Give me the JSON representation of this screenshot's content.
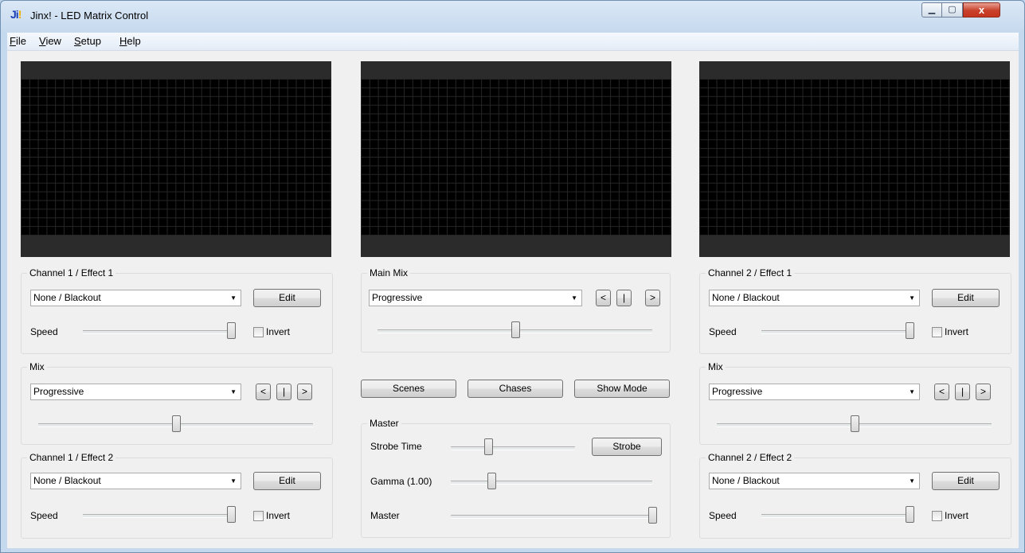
{
  "window": {
    "title": "Jinx! - LED Matrix Control",
    "logo": "Ji!",
    "minimize": "▁",
    "maximize": "▢",
    "close": "x"
  },
  "menu": [
    {
      "accel": "F",
      "rest": "ile"
    },
    {
      "accel": "V",
      "rest": "iew"
    },
    {
      "accel": "S",
      "rest": "etup"
    },
    {
      "accel": "H",
      "rest": "elp"
    }
  ],
  "ch1e1": {
    "legend": "Channel 1 / Effect 1",
    "effect": "None / Blackout",
    "edit": "Edit",
    "speed_label": "Speed",
    "invert_label": "Invert",
    "speed": 1.0,
    "invert": false
  },
  "mix1": {
    "legend": "Mix",
    "mode": "Progressive",
    "prev": "<",
    "stop": "|",
    "next": ">",
    "position": 0.5
  },
  "ch1e2": {
    "legend": "Channel 1 / Effect 2",
    "effect": "None / Blackout",
    "edit": "Edit",
    "speed_label": "Speed",
    "invert_label": "Invert",
    "speed": 1.0,
    "invert": false
  },
  "mainmix": {
    "legend": "Main Mix",
    "mode": "Progressive",
    "prev": "<",
    "stop": "|",
    "next": ">",
    "position": 0.5
  },
  "buttons": {
    "scenes": "Scenes",
    "chases": "Chases",
    "show_mode": "Show Mode"
  },
  "master": {
    "legend": "Master",
    "strobe_time_label": "Strobe Time",
    "strobe_button": "Strobe",
    "gamma_label": "Gamma (1.00)",
    "master_label": "Master",
    "strobe_time": 0.3,
    "gamma": 0.2,
    "master": 1.0
  },
  "ch2e1": {
    "legend": "Channel 2 / Effect 1",
    "effect": "None / Blackout",
    "edit": "Edit",
    "speed_label": "Speed",
    "invert_label": "Invert",
    "speed": 1.0,
    "invert": false
  },
  "mix2": {
    "legend": "Mix",
    "mode": "Progressive",
    "prev": "<",
    "stop": "|",
    "next": ">",
    "position": 0.5
  },
  "ch2e2": {
    "legend": "Channel 2 / Effect 2",
    "effect": "None / Blackout",
    "edit": "Edit",
    "speed_label": "Speed",
    "invert_label": "Invert",
    "speed": 1.0,
    "invert": false
  }
}
